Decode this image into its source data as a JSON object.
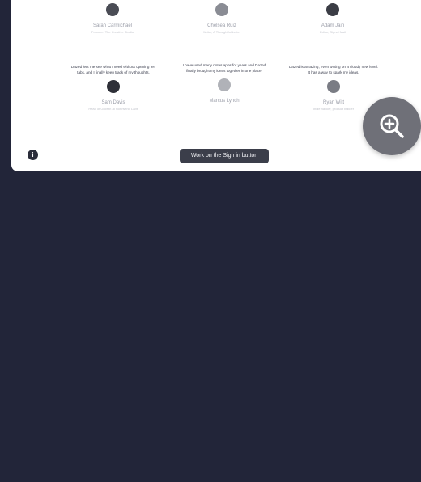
{
  "testimonials": [
    {
      "name": "Sarah Carmichael",
      "role": "Founder, The Creative Studio",
      "avatar_color": "#4a4c55",
      "quote": "Dazed lets me see what I need without opening ten tabs, and I finally keep track of my thoughts.",
      "person_name": "Sam Davis",
      "person_role": "Head of Growth at Northwind Labs",
      "person_avatar_color": "#2e3038"
    },
    {
      "name": "Chelsea Ruiz",
      "role": "Writer, A Thoughtful Letter",
      "avatar_color": "#8a8c94",
      "quote": "I have used many notes apps for years and Dazed finally brought my ideas together in one place.",
      "person_name": "Marcus Lynch",
      "person_role": "Product Designer",
      "person_avatar_color": "#b0b2b8"
    },
    {
      "name": "Adam Jain",
      "role": "Editor, Signal Mail",
      "avatar_color": "#3b3d45",
      "quote": "Dazed is amazing, even writing on a cloudy new level. It has a way to spark my ideas.",
      "person_name": "Ryan Witt",
      "person_role": "Indie hacker, product builder",
      "person_avatar_color": "#7a7c84"
    }
  ],
  "cta_label": "Work on the Sign in button",
  "info_icon": "info-icon",
  "zoom_icon": "zoom-in-icon",
  "colors": {
    "background": "#222539",
    "card": "#ffffff",
    "cta": "#3b3e4a",
    "zoom_button": "#6f7078"
  }
}
